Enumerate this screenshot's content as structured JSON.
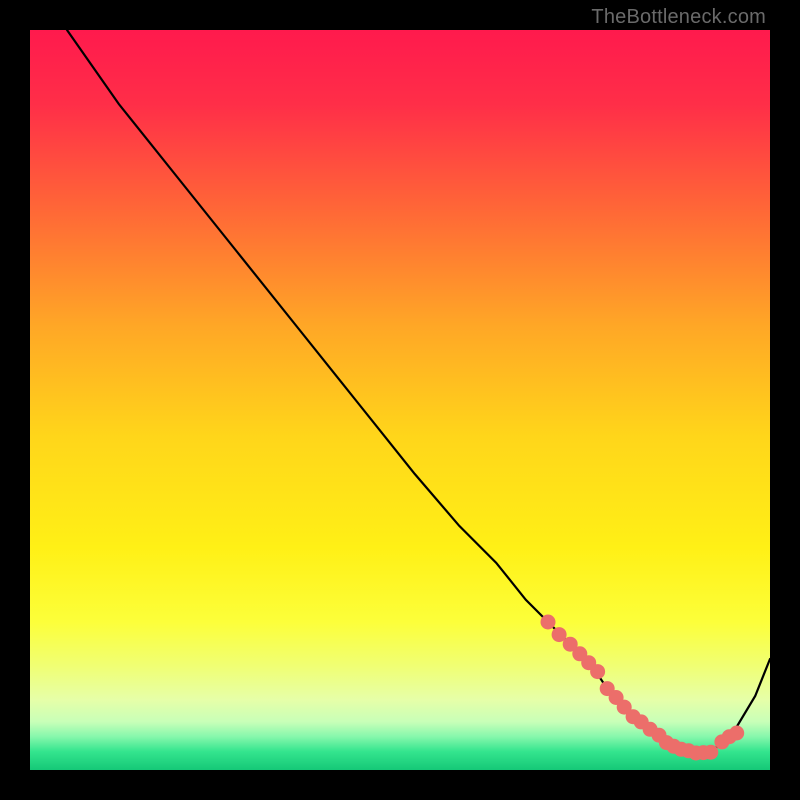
{
  "watermark": "TheBottleneck.com",
  "colors": {
    "bg": "#000000",
    "gradient_stops": [
      {
        "offset": 0.0,
        "color": "#ff1a4d"
      },
      {
        "offset": 0.1,
        "color": "#ff2e48"
      },
      {
        "offset": 0.25,
        "color": "#ff6a36"
      },
      {
        "offset": 0.4,
        "color": "#ffa726"
      },
      {
        "offset": 0.55,
        "color": "#ffd61a"
      },
      {
        "offset": 0.7,
        "color": "#fff016"
      },
      {
        "offset": 0.8,
        "color": "#fcff3a"
      },
      {
        "offset": 0.86,
        "color": "#f0ff74"
      },
      {
        "offset": 0.905,
        "color": "#e6ffa8"
      },
      {
        "offset": 0.935,
        "color": "#c8ffb8"
      },
      {
        "offset": 0.955,
        "color": "#86f7ac"
      },
      {
        "offset": 0.975,
        "color": "#34e58e"
      },
      {
        "offset": 1.0,
        "color": "#15c877"
      }
    ],
    "curve": "#000000",
    "marker": "#ec6e6a"
  },
  "chart_data": {
    "type": "line",
    "title": "",
    "xlabel": "",
    "ylabel": "",
    "xlim": [
      0,
      100
    ],
    "ylim": [
      0,
      100
    ],
    "grid": false,
    "series": [
      {
        "name": "bottleneck-curve",
        "x": [
          5,
          12,
          20,
          28,
          36,
          44,
          52,
          58,
          63,
          67,
          70,
          73,
          76,
          78,
          80,
          82,
          84,
          86,
          88,
          90,
          92,
          95,
          98,
          100
        ],
        "y": [
          100,
          90,
          80,
          70,
          60,
          50,
          40,
          33,
          28,
          23,
          20,
          17,
          14,
          11,
          8.5,
          6.5,
          5,
          3.7,
          2.8,
          2.3,
          2.4,
          5,
          10,
          15
        ]
      }
    ],
    "markers": {
      "name": "highlighted-range",
      "x": [
        70,
        71.5,
        73,
        74.3,
        75.5,
        76.7,
        78,
        79.2,
        80.3,
        81.5,
        82.6,
        83.8,
        85,
        86,
        87,
        88,
        89,
        90,
        91,
        92,
        93.5,
        94.5,
        95.5
      ],
      "y": [
        20,
        18.3,
        17,
        15.7,
        14.5,
        13.3,
        11,
        9.8,
        8.5,
        7.2,
        6.5,
        5.5,
        4.7,
        3.7,
        3.2,
        2.8,
        2.6,
        2.3,
        2.35,
        2.4,
        3.8,
        4.5,
        5
      ]
    }
  }
}
